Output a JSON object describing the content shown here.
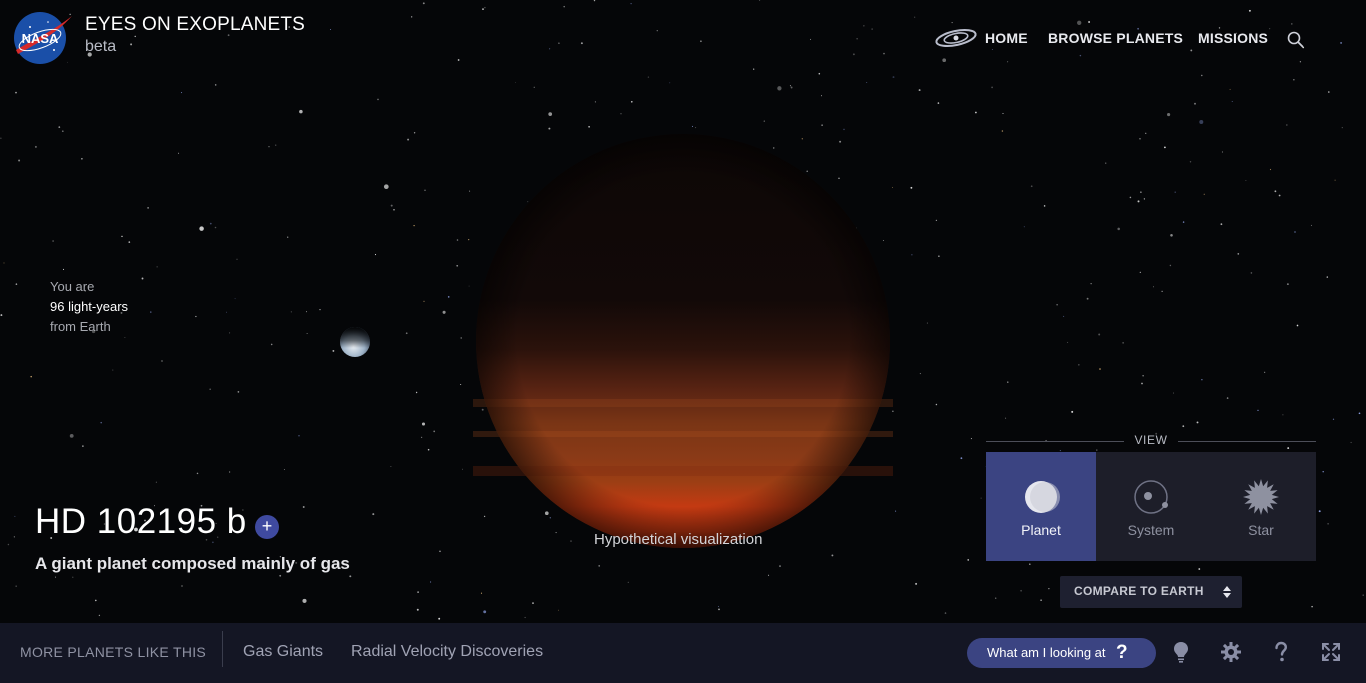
{
  "header": {
    "logo_text": "NASA",
    "app_title": "EYES ON EXOPLANETS",
    "app_subtitle": "beta",
    "nav": [
      {
        "label": "HOME",
        "icon": "galaxy-icon"
      },
      {
        "label": "BROWSE PLANETS"
      },
      {
        "label": "MISSIONS"
      }
    ],
    "search_icon": "search-icon"
  },
  "distance": {
    "line1": "You are",
    "line2": "96 light-years",
    "line3": "from Earth"
  },
  "planet": {
    "name": "HD 102195 b",
    "add_label": "+",
    "description": "A giant planet composed mainly of gas",
    "caption": "Hypothetical visualization"
  },
  "view_panel": {
    "label": "VIEW",
    "options": [
      {
        "label": "Planet",
        "icon": "planet-icon",
        "active": true
      },
      {
        "label": "System",
        "icon": "system-icon",
        "active": false
      },
      {
        "label": "Star",
        "icon": "star-icon",
        "active": false
      }
    ]
  },
  "compare": {
    "label": "COMPARE TO EARTH"
  },
  "footer": {
    "more_label": "MORE PLANETS LIKE THIS",
    "links": [
      "Gas Giants",
      "Radial Velocity Discoveries"
    ],
    "what_label": "What am I looking at",
    "what_q": "?",
    "icons": [
      "lightbulb-icon",
      "gear-icon",
      "help-icon",
      "fullscreen-icon"
    ]
  },
  "colors": {
    "accent": "#3b4482",
    "footer_bg": "#141624",
    "planet_band": "#c43a12"
  }
}
